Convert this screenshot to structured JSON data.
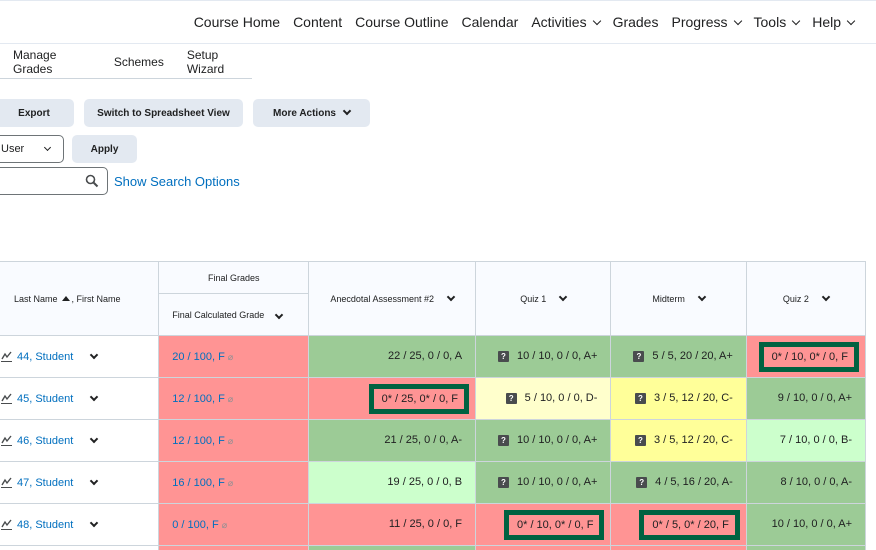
{
  "topnav": {
    "items": [
      {
        "label": "Course Home",
        "dropdown": false
      },
      {
        "label": "Content",
        "dropdown": false
      },
      {
        "label": "Course Outline",
        "dropdown": false
      },
      {
        "label": "Calendar",
        "dropdown": false
      },
      {
        "label": "Activities",
        "dropdown": true
      },
      {
        "label": "Grades",
        "dropdown": false
      },
      {
        "label": "Progress",
        "dropdown": true
      },
      {
        "label": "Tools",
        "dropdown": true
      },
      {
        "label": "Help",
        "dropdown": true
      }
    ]
  },
  "subtabs": [
    "Manage Grades",
    "Schemes",
    "Setup Wizard"
  ],
  "toolbar": {
    "export_label": "Export",
    "spreadsheet_label": "Switch to Spreadsheet View",
    "more_actions_label": "More Actions",
    "view_select_value": "User",
    "apply_label": "Apply",
    "search_value": "",
    "show_search_options_label": "Show Search Options"
  },
  "grid": {
    "name_header": {
      "last": "Last Name",
      "first": ", First Name"
    },
    "final_group_header": "Final Grades",
    "final_header": "Final Calculated Grade",
    "columns": [
      "Anecdotal Assessment #2",
      "Quiz 1",
      "Midterm",
      "Quiz 2"
    ],
    "colors": {
      "red": "#ff9494",
      "green": "#9ccb96",
      "light_green": "#ccffcc",
      "yellow": "#ffff99",
      "light_yellow": "#ffffcc",
      "flag_border": "#006241",
      "link": "#006fbf"
    },
    "rows": [
      {
        "name": "44, Student",
        "final": "20 / 100, F",
        "cells": [
          {
            "text": "22 / 25, 0 / 0, A",
            "color": "green",
            "comment_icon": false,
            "flagged": false
          },
          {
            "text": "10 / 10, 0 / 0, A+",
            "color": "green",
            "comment_icon": true,
            "flagged": false
          },
          {
            "text": "5 / 5, 20 / 20, A+",
            "color": "green",
            "comment_icon": true,
            "flagged": false
          },
          {
            "text": "0* / 10, 0* / 0, F",
            "color": "red",
            "comment_icon": false,
            "flagged": true
          }
        ]
      },
      {
        "name": "45, Student",
        "final": "12 / 100, F",
        "cells": [
          {
            "text": "0* / 25, 0* / 0, F",
            "color": "red",
            "comment_icon": false,
            "flagged": true
          },
          {
            "text": "5 / 10, 0 / 0, D-",
            "color": "light_yellow",
            "comment_icon": true,
            "flagged": false
          },
          {
            "text": "3 / 5, 12 / 20, C-",
            "color": "yellow",
            "comment_icon": true,
            "flagged": false
          },
          {
            "text": "9 / 10, 0 / 0, A+",
            "color": "green",
            "comment_icon": false,
            "flagged": false
          }
        ]
      },
      {
        "name": "46, Student",
        "final": "12 / 100, F",
        "cells": [
          {
            "text": "21 / 25, 0 / 0, A-",
            "color": "green",
            "comment_icon": false,
            "flagged": false
          },
          {
            "text": "10 / 10, 0 / 0, A+",
            "color": "green",
            "comment_icon": true,
            "flagged": false
          },
          {
            "text": "3 / 5, 12 / 20, C-",
            "color": "yellow",
            "comment_icon": true,
            "flagged": false
          },
          {
            "text": "7 / 10, 0 / 0, B-",
            "color": "light_green",
            "comment_icon": false,
            "flagged": false
          }
        ]
      },
      {
        "name": "47, Student",
        "final": "16 / 100, F",
        "cells": [
          {
            "text": "19 / 25, 0 / 0, B",
            "color": "light_green",
            "comment_icon": false,
            "flagged": false
          },
          {
            "text": "10 / 10, 0 / 0, A+",
            "color": "green",
            "comment_icon": true,
            "flagged": false
          },
          {
            "text": "4 / 5, 16 / 20, A-",
            "color": "green",
            "comment_icon": true,
            "flagged": false
          },
          {
            "text": "8 / 10, 0 / 0, A-",
            "color": "green",
            "comment_icon": false,
            "flagged": false
          }
        ]
      },
      {
        "name": "48, Student",
        "final": "0 / 100, F",
        "cells": [
          {
            "text": "11 / 25, 0 / 0, F",
            "color": "red",
            "comment_icon": false,
            "flagged": false
          },
          {
            "text": "0* / 10, 0* / 0, F",
            "color": "red",
            "comment_icon": false,
            "flagged": true
          },
          {
            "text": "0* / 5, 0* / 20, F",
            "color": "red",
            "comment_icon": false,
            "flagged": true
          },
          {
            "text": "10 / 10, 0 / 0, A+",
            "color": "green",
            "comment_icon": false,
            "flagged": false
          }
        ]
      }
    ],
    "partial_row_colors": [
      "red",
      "red",
      "green",
      "red",
      "red",
      "green"
    ]
  }
}
